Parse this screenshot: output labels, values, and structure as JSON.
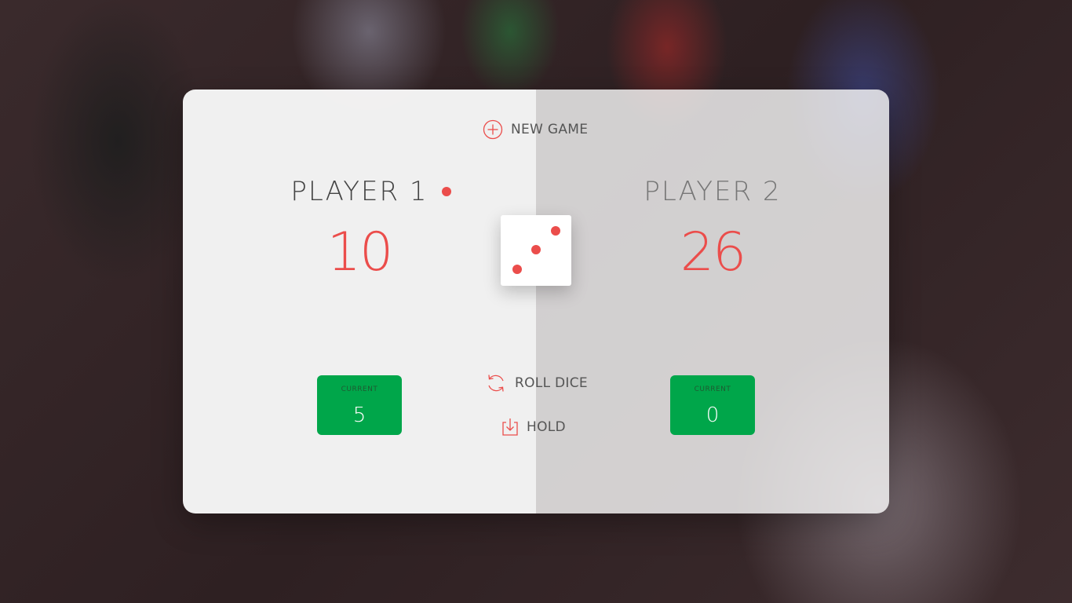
{
  "game": {
    "new_game_label": "NEW GAME",
    "roll_dice_label": "ROLL DICE",
    "hold_label": "HOLD",
    "dice_value": 3,
    "active_player": 1
  },
  "players": [
    {
      "name": "PLAYER 1",
      "score": "10",
      "current_label": "CURRENT",
      "current_score": "5"
    },
    {
      "name": "PLAYER 2",
      "score": "26",
      "current_label": "CURRENT",
      "current_score": "0"
    }
  ],
  "colors": {
    "accent": "#eb4d4b",
    "current_box": "#00a64a",
    "panel_bg": "#f7f7f7"
  },
  "icons": {
    "new_game": "plus-circle-icon",
    "roll_dice": "refresh-icon",
    "hold": "download-icon"
  }
}
